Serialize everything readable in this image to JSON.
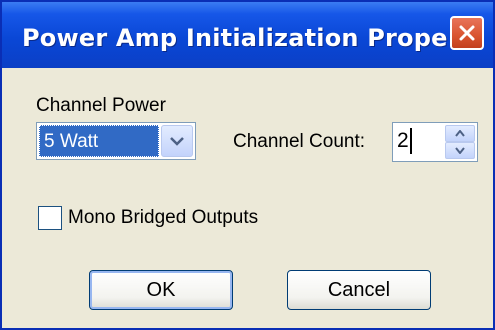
{
  "window": {
    "title": "Power Amp Initialization Prope...",
    "close_icon": "close-icon"
  },
  "channel_power": {
    "label": "Channel Power",
    "selected": "5 Watt"
  },
  "channel_count": {
    "label": "Channel Count:",
    "value": "2"
  },
  "mono_bridged": {
    "label": "Mono Bridged Outputs",
    "checked": false
  },
  "buttons": {
    "ok": "OK",
    "cancel": "Cancel"
  },
  "colors": {
    "titlebar": "#0a47d6",
    "selection": "#316ac5",
    "close": "#d9542f"
  }
}
